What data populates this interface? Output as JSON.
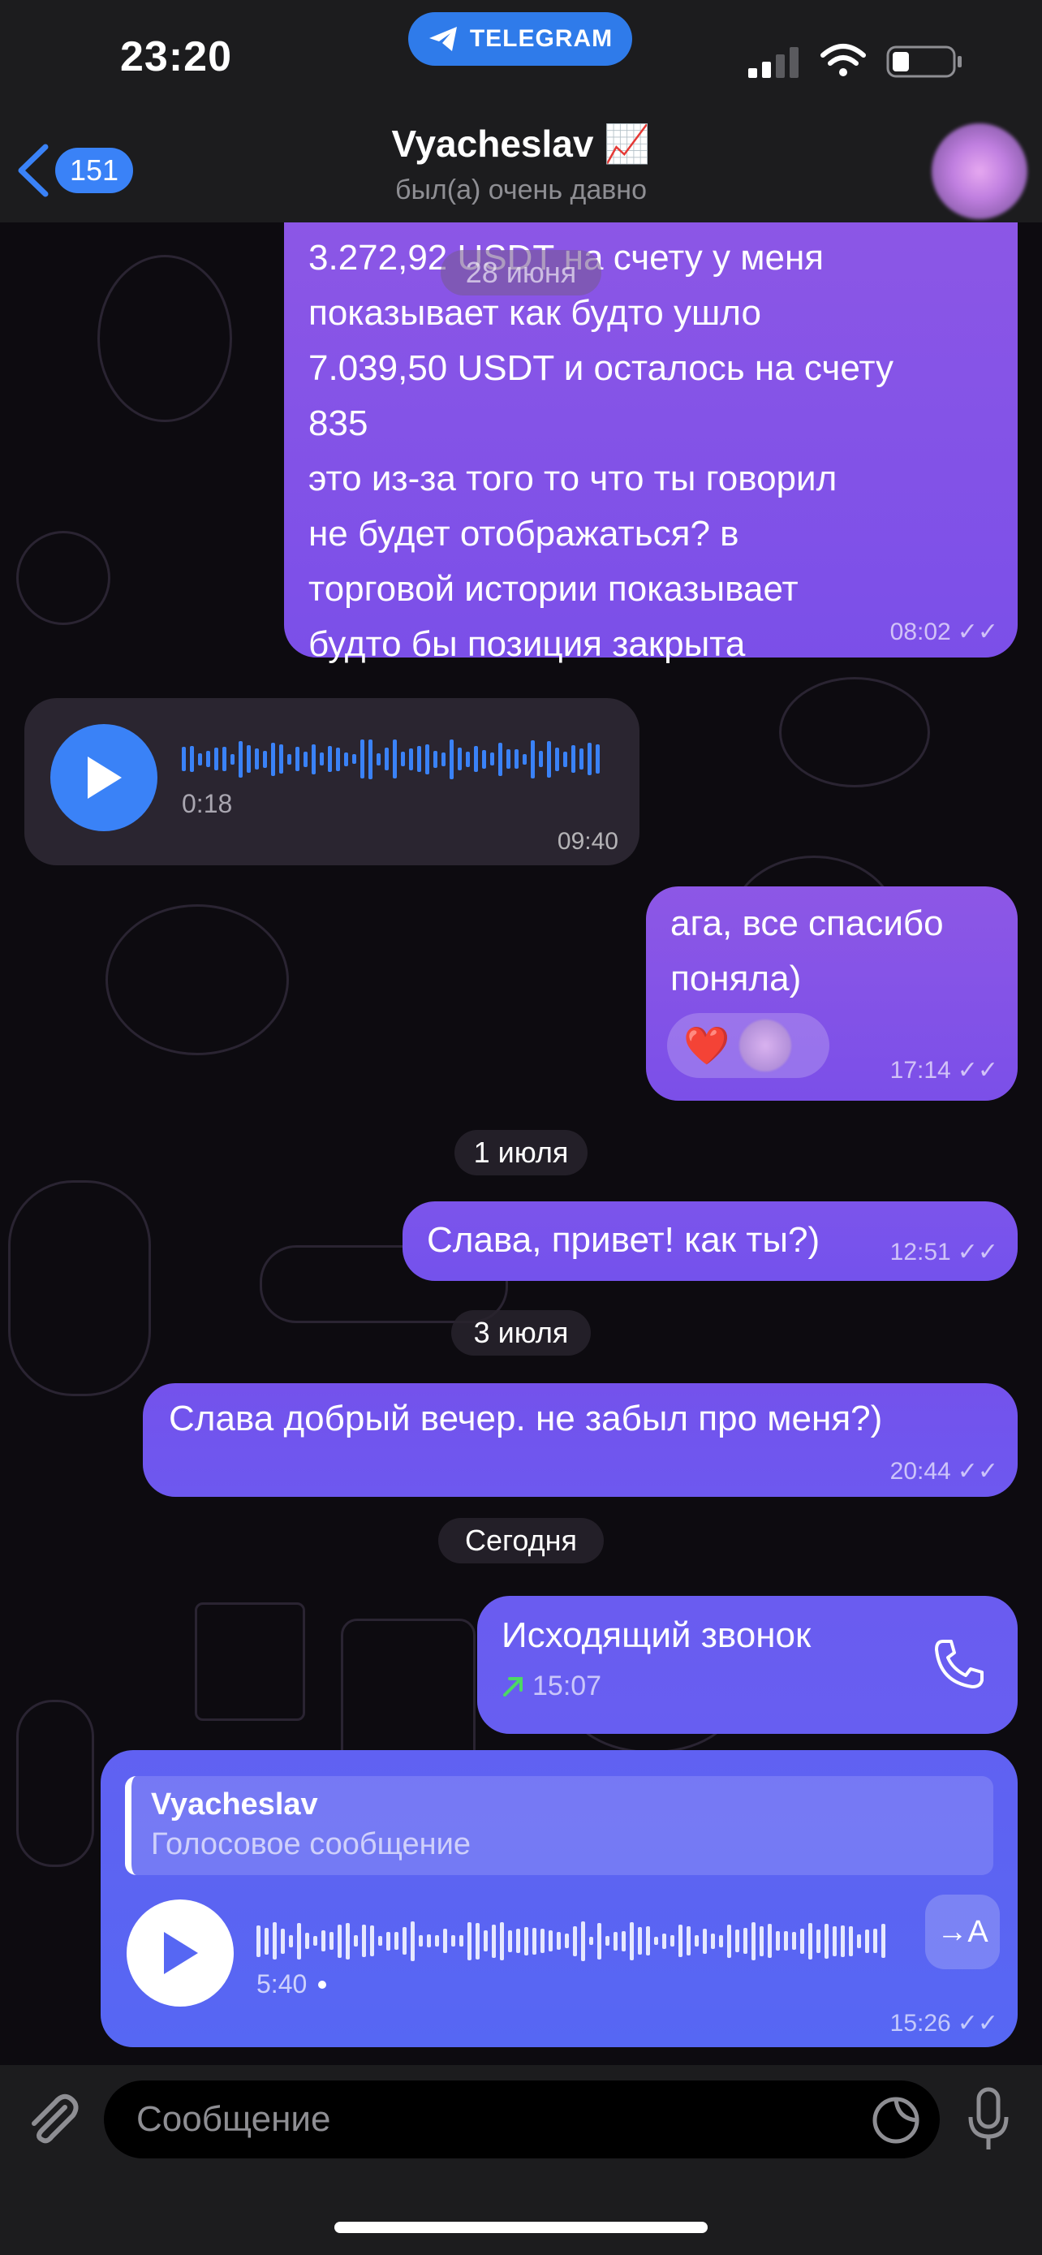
{
  "status_bar": {
    "time": "23:20",
    "pill_label": "TELEGRAM"
  },
  "header": {
    "back_count": "151",
    "title": "Vyacheslav",
    "title_emoji": "📈",
    "subtitle": "был(а) очень давно"
  },
  "messages": [
    {
      "type": "text",
      "direction": "out",
      "text": "3.272,92 USDT на счету у меня\nпоказывает как будто ушло\n7.039,50 USDT и осталось на счету\n835\nэто из-за того то что ты говорил\nне будет отображаться? в\nторговой истории показывает\nбудто бы позиция закрыта",
      "time": "08:02"
    },
    {
      "type": "voice",
      "direction": "in",
      "duration": "0:18",
      "time": "09:40"
    },
    {
      "type": "text",
      "direction": "out",
      "text": "ага, все спасибо\nпоняла)",
      "time": "17:14",
      "reaction": "❤️"
    },
    {
      "type": "text",
      "direction": "out",
      "text": "Слава, привет! как ты?)",
      "time": "12:51"
    },
    {
      "type": "text",
      "direction": "out",
      "text": "Слава добрый вечер. не забыл про меня?)",
      "time": "20:44"
    },
    {
      "type": "call",
      "direction": "out",
      "title": "Исходящий звонок",
      "call_time": "15:07"
    },
    {
      "type": "voice_reply",
      "direction": "out",
      "reply_author": "Vyacheslav",
      "reply_text": "Голосовое сообщение",
      "duration": "5:40",
      "transcribe_label": "→A",
      "time": "15:26"
    }
  ],
  "date_separators": {
    "top_overlay": "28 июня",
    "d1": "1 июля",
    "d2": "3 июля",
    "d3": "Сегодня"
  },
  "input": {
    "placeholder": "Сообщение"
  },
  "colors": {
    "accent": "#3a82f7",
    "outgoing_bubble": "#8d57e6",
    "outgoing_bubble_bottom": "#5b62f0",
    "incoming_bubble": "#2a2530",
    "call_arrow": "#4cd964"
  }
}
